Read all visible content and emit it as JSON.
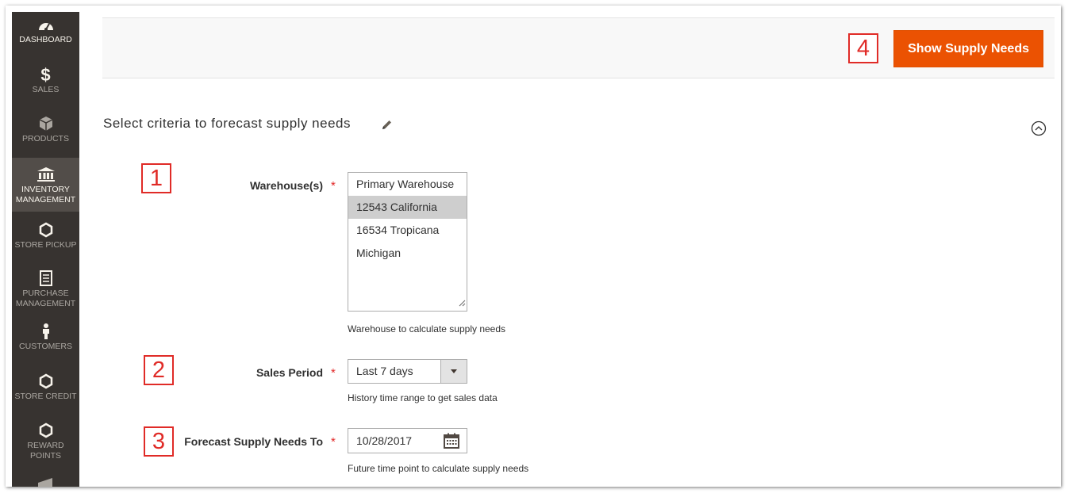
{
  "sidebar": {
    "items": [
      {
        "label": "DASHBOARD",
        "icon": "dashboard-icon"
      },
      {
        "label": "$",
        "sublabel": "SALES",
        "icon": "dollar-icon"
      },
      {
        "label": "PRODUCTS",
        "icon": "box-icon"
      },
      {
        "label": "INVENTORY MANAGEMENT",
        "icon": "bank-icon"
      },
      {
        "label": "STORE PICKUP",
        "icon": "hexagon-icon"
      },
      {
        "label": "PURCHASE MANAGEMENT",
        "icon": "document-icon"
      },
      {
        "label": "CUSTOMERS",
        "icon": "person-icon"
      },
      {
        "label": "STORE CREDIT",
        "icon": "hexagon-icon"
      },
      {
        "label": "REWARD POINTS",
        "icon": "hexagon-icon"
      }
    ]
  },
  "header": {
    "primary_button": "Show Supply Needs",
    "callout": "4"
  },
  "section": {
    "title": "Select criteria to forecast supply needs"
  },
  "form": {
    "warehouses": {
      "callout": "1",
      "label": "Warehouse(s)",
      "required_mark": "*",
      "options": [
        "Primary Warehouse",
        "12543 California",
        "16534 Tropicana",
        "Michigan"
      ],
      "selected": "12543 California",
      "note": "Warehouse to calculate supply needs"
    },
    "sales_period": {
      "callout": "2",
      "label": "Sales Period",
      "required_mark": "*",
      "value": "Last 7 days",
      "note": "History time range to get sales data"
    },
    "forecast_to": {
      "callout": "3",
      "label": "Forecast Supply Needs To",
      "required_mark": "*",
      "value": "10/28/2017",
      "note": "Future time point to calculate supply needs"
    }
  },
  "colors": {
    "sidebar_bg": "#373330",
    "sidebar_active": "#524d49",
    "primary": "#eb5202",
    "callout": "#e02b27",
    "required": "#e22626"
  }
}
